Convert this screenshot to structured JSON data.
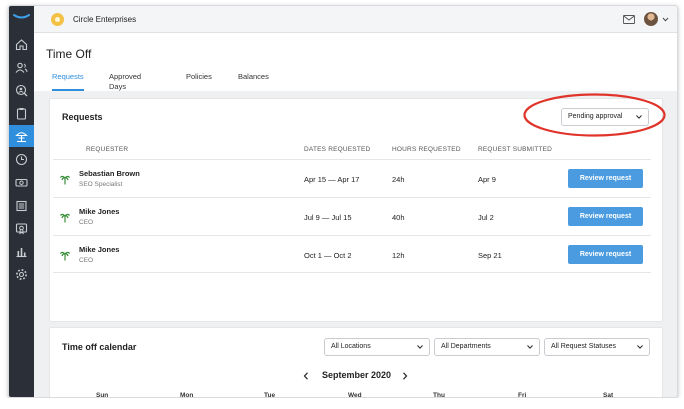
{
  "topbar": {
    "company_name": "Circle Enterprises"
  },
  "page": {
    "title": "Time Off",
    "tabs": [
      {
        "label": "Requests",
        "active": true
      },
      {
        "label": "Approved Days",
        "active": false
      },
      {
        "label": "Policies",
        "active": false
      },
      {
        "label": "Balances",
        "active": false
      }
    ]
  },
  "requests": {
    "title": "Requests",
    "filter_value": "Pending approval",
    "columns": [
      "REQUESTER",
      "DATES REQUESTED",
      "HOURS REQUESTED",
      "REQUEST SUBMITTED"
    ],
    "rows": [
      {
        "name": "Sebastian Brown",
        "role": "SEO Specialist",
        "dates": "Apr 15 — Apr 17",
        "hours": "24h",
        "submitted": "Apr 9",
        "action": "Review request"
      },
      {
        "name": "Mike Jones",
        "role": "CEO",
        "dates": "Jul 9 — Jul 15",
        "hours": "40h",
        "submitted": "Jul 2",
        "action": "Review request"
      },
      {
        "name": "Mike Jones",
        "role": "CEO",
        "dates": "Oct 1 — Oct 2",
        "hours": "12h",
        "submitted": "Sep 21",
        "action": "Review request"
      }
    ]
  },
  "calendar": {
    "title": "Time off calendar",
    "filters": [
      "All Locations",
      "All Departments",
      "All Request Statuses"
    ],
    "month": "September 2020",
    "weekdays": [
      "Sun",
      "Mon",
      "Tue",
      "Wed",
      "Thu",
      "Fri",
      "Sat"
    ]
  },
  "colors": {
    "accent": "#2f8fdd",
    "annotation": "#e0342b",
    "sidebar": "#2b3038",
    "button": "#4a9be0"
  },
  "icons": {
    "sidebar": [
      "home-icon",
      "people-icon",
      "search-person-icon",
      "clipboard-icon",
      "beach-umbrella-icon",
      "clock-icon",
      "money-icon",
      "documents-icon",
      "certificate-icon",
      "bar-chart-icon",
      "gear-icon"
    ],
    "row": "palm-tree-icon"
  }
}
